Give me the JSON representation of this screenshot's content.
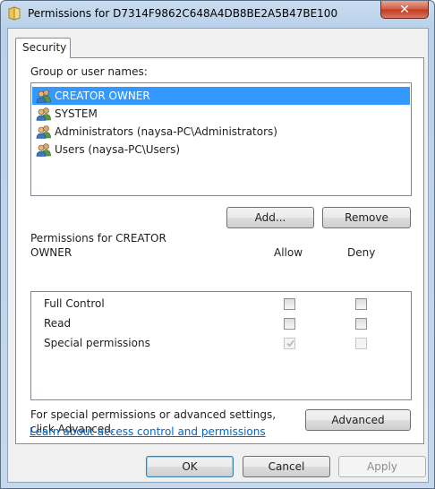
{
  "window": {
    "title": "Permissions for D7314F9862C648A4DB8BE2A5B47BE100",
    "close_glyph": "✕"
  },
  "tabs": [
    {
      "label": "Security",
      "active": true
    }
  ],
  "groups": {
    "label": "Group or user names:",
    "items": [
      {
        "label": "CREATOR OWNER",
        "selected": true
      },
      {
        "label": "SYSTEM",
        "selected": false
      },
      {
        "label": "Administrators (naysa-PC\\Administrators)",
        "selected": false
      },
      {
        "label": "Users (naysa-PC\\Users)",
        "selected": false
      }
    ],
    "add_label": "Add...",
    "remove_label": "Remove"
  },
  "permissions": {
    "header_line1": "Permissions for CREATOR",
    "header_line2": "OWNER",
    "allow_label": "Allow",
    "deny_label": "Deny",
    "rows": [
      {
        "name": "Full Control",
        "allow": false,
        "deny": false,
        "allow_enabled": true,
        "deny_enabled": true
      },
      {
        "name": "Read",
        "allow": false,
        "deny": false,
        "allow_enabled": true,
        "deny_enabled": true
      },
      {
        "name": "Special permissions",
        "allow": true,
        "deny": false,
        "allow_enabled": false,
        "deny_enabled": false
      }
    ]
  },
  "advanced": {
    "text_line1": "For special permissions or advanced settings,",
    "text_line2": "click Advanced.",
    "button_label": "Advanced"
  },
  "link": {
    "label": "Learn about access control and permissions"
  },
  "footer": {
    "ok_label": "OK",
    "cancel_label": "Cancel",
    "apply_label": "Apply"
  },
  "colors": {
    "selection": "#3399ff",
    "link": "#0066cc",
    "close_button": "#c2391f"
  },
  "icons": {
    "title": "folder-icon",
    "user": "users-icon",
    "close": "close-icon",
    "check": "check-icon"
  }
}
